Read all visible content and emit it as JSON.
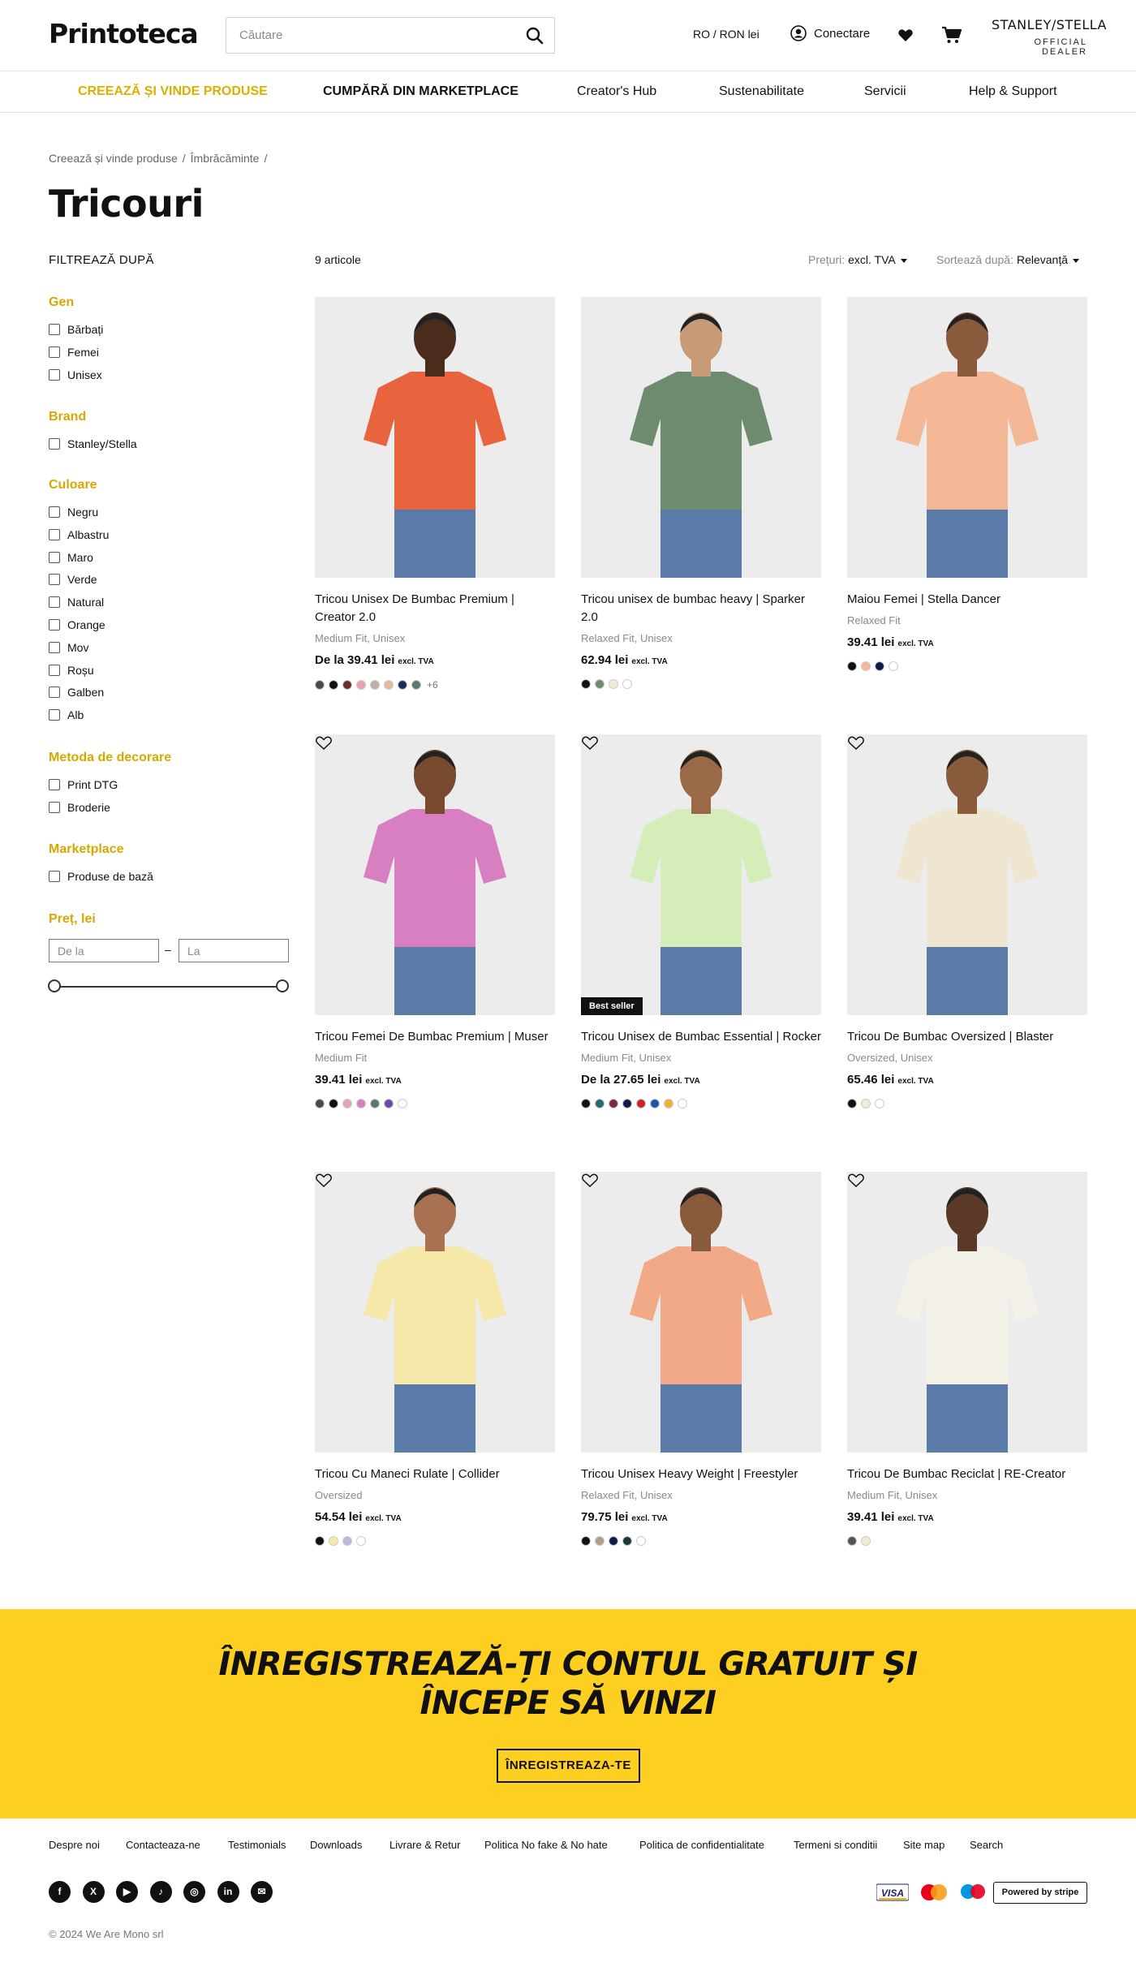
{
  "header": {
    "logo": "Printoteca",
    "search_placeholder": "Căutare",
    "lang": "RO / RON lei",
    "login": "Conectare",
    "dealer_brand": "STANLEY/STELLA",
    "dealer_sub": "OFFICIAL DEALER"
  },
  "nav": [
    {
      "label": "CREEAZĂ ȘI VINDE PRODUSE"
    },
    {
      "label": "CUMPĂRĂ DIN MARKETPLACE"
    },
    {
      "label": "Creator's Hub"
    },
    {
      "label": "Sustenabilitate"
    },
    {
      "label": "Servicii"
    },
    {
      "label": "Help & Support"
    }
  ],
  "breadcrumb": [
    "Creează și vinde produse",
    "Îmbrăcăminte"
  ],
  "page_title": "Tricouri",
  "filters": {
    "heading": "FILTREAZĂ DUPĂ",
    "groups": [
      {
        "title": "Gen",
        "options": [
          "Bărbați",
          "Femei",
          "Unisex"
        ]
      },
      {
        "title": "Brand",
        "options": [
          "Stanley/Stella"
        ]
      },
      {
        "title": "Culoare",
        "options": [
          "Negru",
          "Albastru",
          "Maro",
          "Verde",
          "Natural",
          "Orange",
          "Mov",
          "Roșu",
          "Galben",
          "Alb"
        ]
      },
      {
        "title": "Metoda de decorare",
        "options": [
          "Print DTG",
          "Broderie"
        ]
      },
      {
        "title": "Marketplace",
        "options": [
          "Produse de bază"
        ]
      }
    ],
    "price_title": "Preț, lei",
    "price_from_placeholder": "De la",
    "price_to_placeholder": "La",
    "price_dash": "–"
  },
  "toolbar": {
    "count": "9 articole",
    "price_label": "Prețuri:",
    "price_value": "excl. TVA",
    "sort_label": "Sortează după:",
    "sort_value": "Relevanță"
  },
  "products": [
    {
      "name": "Tricou Unisex De Bumbac Premium | Creator 2.0",
      "fit": "Medium Fit, Unisex",
      "price": "De la 39.41 lei",
      "vat": "excl. TVA",
      "badge": "",
      "shirt": "#e8643f",
      "skin": "#4a2c1c",
      "swatches": [
        "#4a4a4a",
        "#111111",
        "#6b2e2e",
        "#e8a3b0",
        "#b8b3a8",
        "#e8b89a",
        "#1a2a5a",
        "#5a7a6a"
      ],
      "more": "+6"
    },
    {
      "name": "Tricou unisex de bumbac heavy | Sparker 2.0",
      "fit": "Relaxed Fit, Unisex",
      "price": "62.94 lei",
      "vat": "excl. TVA",
      "badge": "",
      "shirt": "#6d8c6e",
      "skin": "#c79b78",
      "swatches": [
        "#111111",
        "#6d8c6e",
        "#f3ead4",
        "#ffffff"
      ],
      "more": ""
    },
    {
      "name": "Maiou Femei | Stella Dancer",
      "fit": "Relaxed Fit",
      "price": "39.41 lei",
      "vat": "excl. TVA",
      "badge": "",
      "shirt": "#f4b896",
      "skin": "#8a5a3c",
      "swatches": [
        "#111111",
        "#f4b896",
        "#111a4a",
        "#ffffff"
      ],
      "more": ""
    },
    {
      "name": "Tricou Femei De Bumbac Premium | Muser",
      "fit": "Medium Fit",
      "price": "39.41 lei",
      "vat": "excl. TVA",
      "badge": "",
      "shirt": "#d77fc0",
      "skin": "#7a4a2e",
      "swatches": [
        "#4a4a4a",
        "#111111",
        "#e8a3b0",
        "#d77fc0",
        "#5a7a6a",
        "#6b4aa0",
        "#ffffff"
      ],
      "more": ""
    },
    {
      "name": "Tricou Unisex de Bumbac Essential | Rocker",
      "fit": "Medium Fit, Unisex",
      "price": "De la 27.65 lei",
      "vat": "excl. TVA",
      "badge": "Best seller",
      "shirt": "#d5edb8",
      "skin": "#9a6a48",
      "swatches": [
        "#111111",
        "#2a6a6a",
        "#7a2a3a",
        "#111a4a",
        "#d0202a",
        "#1a5aa0",
        "#f0b030",
        "#ffffff"
      ],
      "more": ""
    },
    {
      "name": "Tricou De Bumbac Oversized | Blaster",
      "fit": "Oversized, Unisex",
      "price": "65.46 lei",
      "vat": "excl. TVA",
      "badge": "",
      "shirt": "#efe6d2",
      "skin": "#8a5a3c",
      "swatches": [
        "#111111",
        "#f3ead4",
        "#ffffff"
      ],
      "more": ""
    },
    {
      "name": "Tricou Cu Maneci Rulate | Collider",
      "fit": "Oversized",
      "price": "54.54 lei",
      "vat": "excl. TVA",
      "badge": "",
      "shirt": "#f6e8a8",
      "skin": "#a87252",
      "swatches": [
        "#111111",
        "#f6e8a8",
        "#b8bcd8",
        "#ffffff"
      ],
      "more": ""
    },
    {
      "name": "Tricou Unisex Heavy Weight | Freestyler",
      "fit": "Relaxed Fit, Unisex",
      "price": "79.75 lei",
      "vat": "excl. TVA",
      "badge": "",
      "shirt": "#f1a987",
      "skin": "#8a5a3c",
      "swatches": [
        "#111111",
        "#b0a08a",
        "#111a4a",
        "#1a3a3a",
        "#ffffff"
      ],
      "more": ""
    },
    {
      "name": "Tricou De Bumbac Reciclat | RE-Creator",
      "fit": "Medium Fit, Unisex",
      "price": "39.41 lei",
      "vat": "excl. TVA",
      "badge": "",
      "shirt": "#f4f1e8",
      "skin": "#5a3a26",
      "swatches": [
        "#555555",
        "#f3ead4"
      ],
      "more": ""
    }
  ],
  "cta": {
    "line1": "ÎNREGISTREAZĂ-ȚI CONTUL GRATUIT ȘI",
    "line2": "ÎNCEPE SĂ VINZI",
    "button": "ÎNREGISTREAZA-TE"
  },
  "footer": {
    "links": [
      "Despre noi",
      "Contacteaza-ne",
      "Testimonials",
      "Downloads",
      "Livrare & Retur",
      "Politica No fake & No hate",
      "Politica de confidentialitate",
      "Termeni si conditii",
      "Site map",
      "Search"
    ],
    "social": [
      {
        "icon": "facebook-icon",
        "glyph": "f"
      },
      {
        "icon": "x-icon",
        "glyph": "X"
      },
      {
        "icon": "youtube-icon",
        "glyph": "▶"
      },
      {
        "icon": "tiktok-icon",
        "glyph": "♪"
      },
      {
        "icon": "instagram-icon",
        "glyph": "◎"
      },
      {
        "icon": "linkedin-icon",
        "glyph": "in"
      },
      {
        "icon": "email-icon",
        "glyph": "✉"
      }
    ],
    "payments": [
      "VISA",
      "Powered by stripe"
    ],
    "copyright": "© 2024 We Are Mono srl"
  },
  "colors": {
    "accent": "#d9b000",
    "cta_bg": "#fccf21"
  }
}
